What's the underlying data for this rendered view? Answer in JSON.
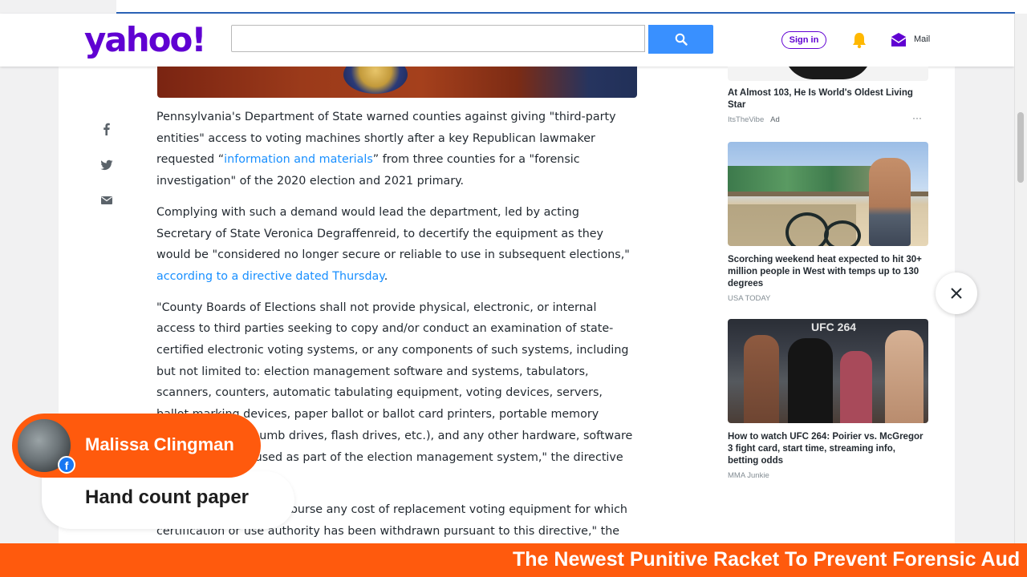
{
  "header": {
    "logo": "yahoo!",
    "search_placeholder": "",
    "signin_label": "Sign in",
    "mail_label": "Mail"
  },
  "article": {
    "p1_before": "Pennsylvania's Department of State warned counties against giving \"third-party entities\" access to voting machines shortly after a key Republican lawmaker requested “",
    "p1_link": "information and materials",
    "p1_after": "” from three counties for a \"forensic investigation\" of the 2020 election and 2021 primary.",
    "p2_before": "Complying with such a demand would lead the department, led by acting Secretary of State Veronica Degraffenreid, to decertify the equipment as they would be \"considered no longer secure or reliable to use in subsequent elections,\" ",
    "p2_link": "according to a directive dated Thursday",
    "p2_after": ".",
    "p3": "\"County Boards of Elections shall not provide physical, electronic, or internal access to third parties seeking to copy and/or conduct an examination of state-certified electronic voting systems, or any components of such systems, including but not limited to: election management software and systems, tabulators, scanners, counters, automatic tabulating equipment, voting devices, servers, ballot marking devices, paper ballot or ballot card printers, portable memory media devices (thumb drives, flash drives, etc.), and any other hardware, software or devices being used as part of the election management system,\" the directive said.",
    "p4": "\"The state will not reimburse any cost of replacement voting equipment for which certification or use authority has been withdrawn pursuant to this directive,\" the memo added."
  },
  "sidebar": {
    "items": [
      {
        "title": "At Almost 103, He Is World's Oldest Living Star",
        "source": "ItsTheVibe",
        "badge": "Ad",
        "more": "···"
      },
      {
        "title": "Scorching weekend heat expected to hit 30+ million people in West with temps up to 130 degrees",
        "source": "USA TODAY"
      },
      {
        "title": "How to watch UFC 264: Poirier vs. McGregor 3 fight card, start time, streaming info, betting odds",
        "source": "MMA Junkie",
        "image_text": "UFC 264"
      }
    ]
  },
  "overlay": {
    "commenter_name": "Malissa Clingman",
    "comment_text": "Hand count paper",
    "ticker_text": "The Newest Punitive Racket To Prevent Forensic Aud"
  },
  "colors": {
    "yahoo_purple": "#6001d2",
    "search_blue": "#3990ff",
    "link_blue": "#188fff",
    "overlay_orange": "#ff5a0d"
  }
}
